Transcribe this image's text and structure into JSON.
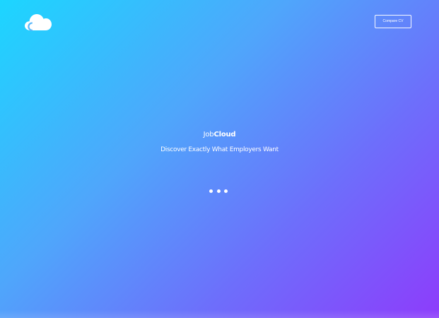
{
  "header": {
    "logo_icon": "cloud-icon",
    "compare_button_label": "Compare CV"
  },
  "hero": {
    "brand_light": "Job",
    "brand_bold": "Cloud",
    "tagline": "Discover Exactly What Employers Want"
  },
  "loader": {
    "icon": "loading-dots-icon",
    "dot_count": 3
  },
  "colors": {
    "gradient_start": "#1cd6ff",
    "gradient_end": "#8d3cfb",
    "text": "#ffffff"
  }
}
